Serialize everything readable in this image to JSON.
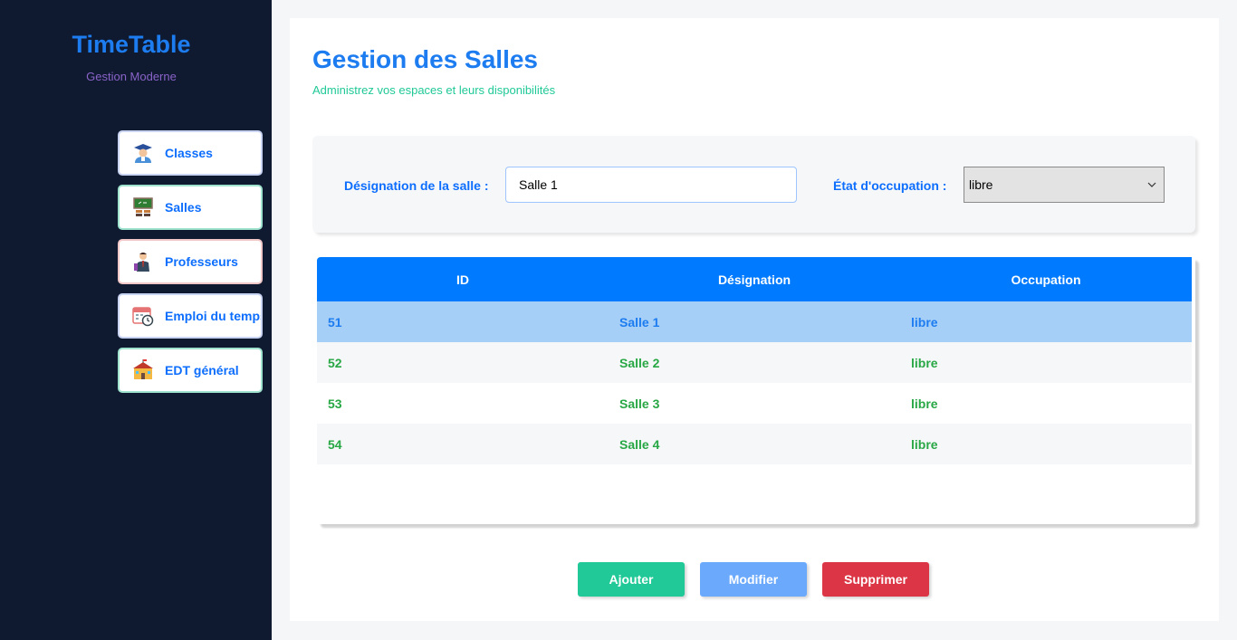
{
  "brand": {
    "title": "TimeTable",
    "subtitle": "Gestion Moderne"
  },
  "sidebar": {
    "items": [
      {
        "label": "Classes",
        "icon": "teacher-icon"
      },
      {
        "label": "Salles",
        "icon": "classroom-icon"
      },
      {
        "label": "Professeurs",
        "icon": "professor-icon"
      },
      {
        "label": "Emploi du temps",
        "icon": "calendar-clock-icon"
      },
      {
        "label": "EDT général",
        "icon": "school-icon"
      }
    ]
  },
  "page": {
    "title": "Gestion des Salles",
    "subtitle": "Administrez vos espaces et leurs disponibilités"
  },
  "form": {
    "designation_label": "Désignation de la salle :",
    "designation_value": "Salle 1",
    "etat_label": "État d'occupation :",
    "etat_value": "libre"
  },
  "table": {
    "headers": [
      "ID",
      "Désignation",
      "Occupation"
    ],
    "rows": [
      {
        "id": "51",
        "designation": "Salle 1",
        "occupation": "libre",
        "selected": true
      },
      {
        "id": "52",
        "designation": "Salle 2",
        "occupation": "libre"
      },
      {
        "id": "53",
        "designation": "Salle 3",
        "occupation": "libre"
      },
      {
        "id": "54",
        "designation": "Salle 4",
        "occupation": "libre"
      }
    ]
  },
  "buttons": {
    "add": "Ajouter",
    "edit": "Modifier",
    "delete": "Supprimer"
  },
  "colors": {
    "sidebar_bg": "#0f1a30",
    "primary": "#007bff",
    "brand_blue": "#1c7cf0",
    "success": "#20c997",
    "danger": "#dc3545",
    "row_selected": "#a6cff7"
  }
}
